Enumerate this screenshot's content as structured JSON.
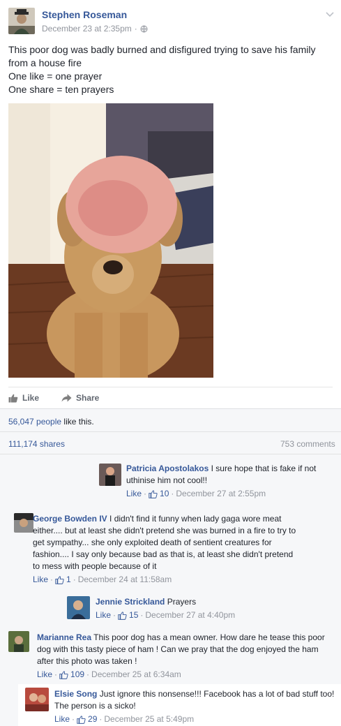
{
  "post": {
    "author": "Stephen Roseman",
    "date": "December 23 at 2:35pm",
    "privacy_icon": "globe-icon",
    "text_lines": [
      "This poor dog was badly burned and disfigured trying to save his family",
      "from a house fire",
      "One like = one prayer",
      "One share = ten prayers"
    ]
  },
  "actions": {
    "like": "Like",
    "share": "Share"
  },
  "likes": {
    "count": "56,047 people",
    "suffix": "like this."
  },
  "shares": "111,174 shares",
  "comments_count": "753 comments",
  "comments": [
    {
      "name": "Patricia Apostolakos",
      "lines": [
        "I sure hope that is fake if not",
        "uthinise him not cool!!"
      ],
      "like_label": "Like",
      "likes": "10",
      "date": "December 27 at 2:55pm"
    },
    {
      "name": "George Bowden IV",
      "lines": [
        "I didn't find it funny when lady gaga wore meat",
        "either.... but at least she didn't pretend she was burned in a fire to try to",
        "get sympathy... she only exploited death of sentient creatures for",
        "fashion.... I say only because bad as that is, at least she didn't pretend",
        "to mess with people because of it"
      ],
      "like_label": "Like",
      "likes": "1",
      "date": "December 24 at 11:58am"
    },
    {
      "name": "Jennie Strickland",
      "lines": [
        "Prayers"
      ],
      "like_label": "Like",
      "likes": "15",
      "date": "December 27 at 4:40pm"
    },
    {
      "name": "Marianne Rea",
      "lines": [
        "This poor dog has a mean owner. How dare he tease this poor",
        "dog with this tasty piece of ham ! Can we pray that the dog enjoyed the ham",
        "after this photo was taken !"
      ],
      "like_label": "Like",
      "likes": "109",
      "date": "December 25 at 6:34am"
    },
    {
      "name": "Elsie Song",
      "lines": [
        "Just ignore this nonsense!!! Facebook has a lot of bad stuff too!",
        "The person is a sicko!"
      ],
      "like_label": "Like",
      "likes": "29",
      "date": "December 25 at 5:49pm"
    }
  ],
  "colors": {
    "link": "#365899",
    "meta": "#90949c",
    "ufi_bg": "#f6f7f9"
  }
}
